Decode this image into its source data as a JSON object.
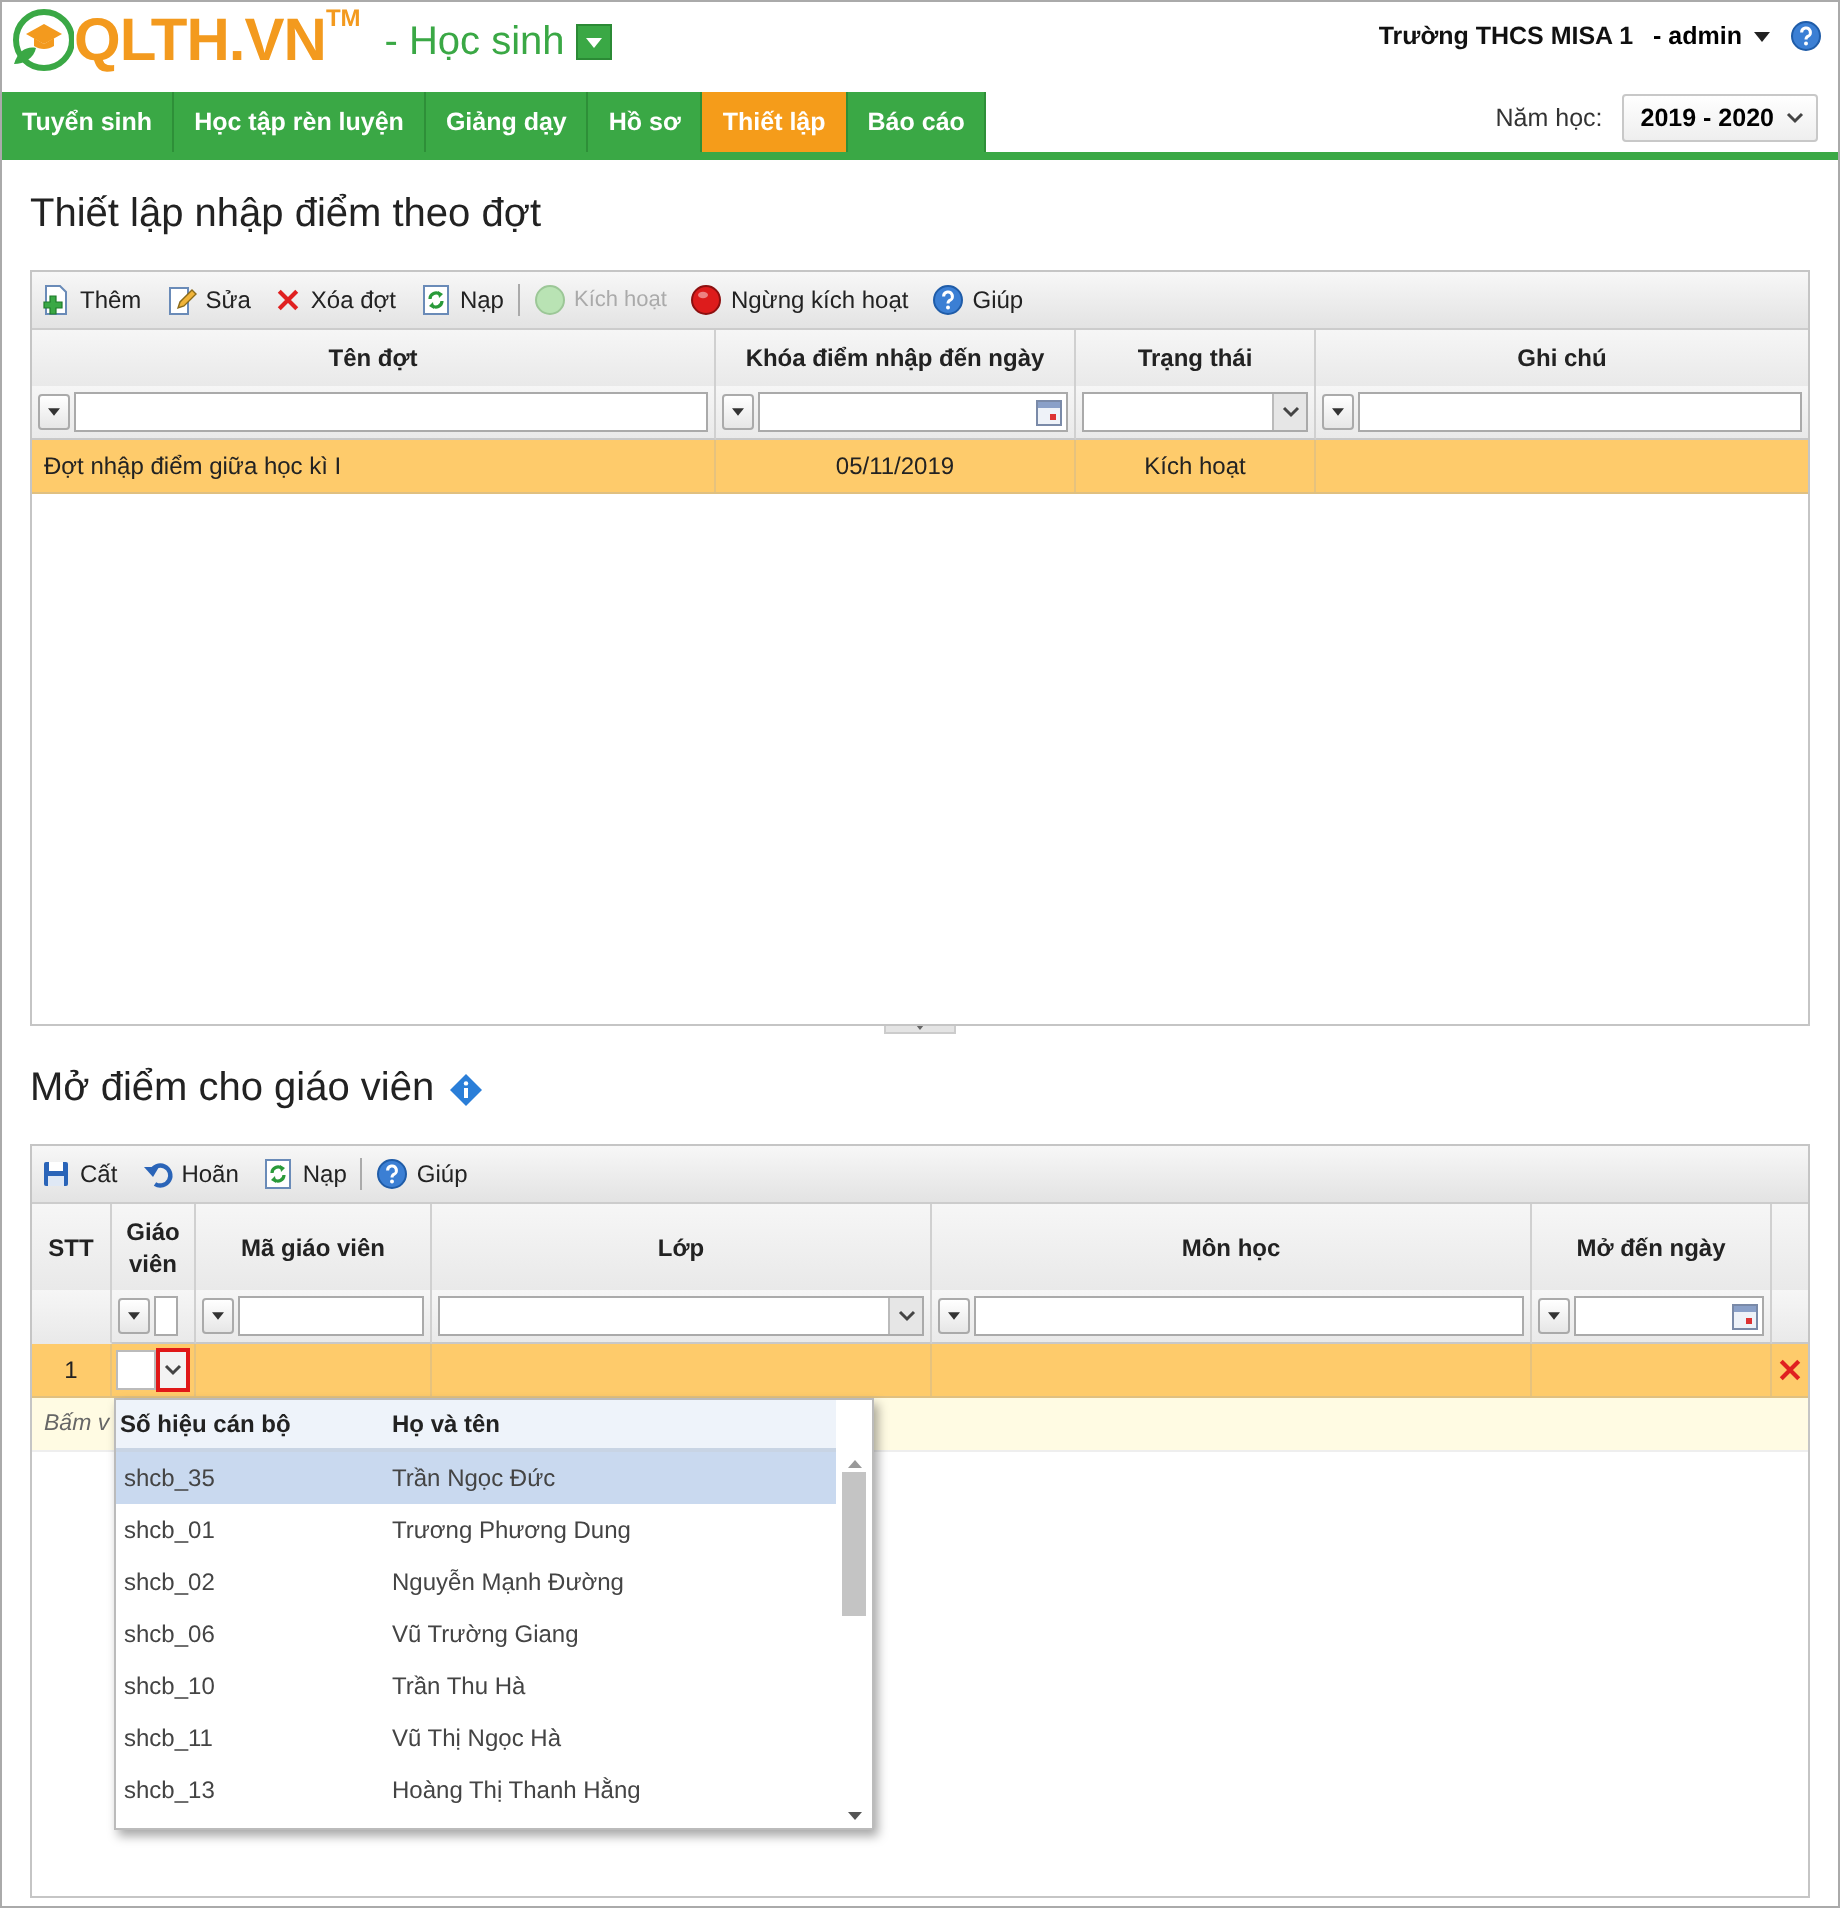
{
  "header": {
    "logo": "QLTH.VN",
    "trademark": "TM",
    "role": "- Học sinh",
    "school": "Trường THCS MISA 1",
    "user": "- admin"
  },
  "nav": {
    "tabs": [
      {
        "label": "Tuyển sinh",
        "selected": false
      },
      {
        "label": "Học tập rèn luyện",
        "selected": false
      },
      {
        "label": "Giảng dạy",
        "selected": false
      },
      {
        "label": "Hồ sơ",
        "selected": false
      },
      {
        "label": "Thiết lập",
        "selected": true
      },
      {
        "label": "Báo cáo",
        "selected": false
      }
    ],
    "year_label": "Năm học:",
    "year": "2019 - 2020"
  },
  "batches": {
    "title": "Thiết lập nhập điểm theo đợt",
    "toolbar": [
      {
        "kind": "add",
        "label": "Thêm",
        "disabled": false
      },
      {
        "kind": "edit",
        "label": "Sửa",
        "disabled": false
      },
      {
        "kind": "delete",
        "label": "Xóa đợt",
        "disabled": false
      },
      {
        "kind": "reload",
        "label": "Nạp",
        "disabled": false
      },
      {
        "kind": "separator"
      },
      {
        "kind": "activate",
        "label": "Kích hoạt",
        "disabled": true
      },
      {
        "kind": "deactivate",
        "label": "Ngừng kích hoạt",
        "disabled": false
      },
      {
        "kind": "help",
        "label": "Giúp",
        "disabled": false
      }
    ],
    "columns": [
      {
        "label": "Tên đợt",
        "kind": "text"
      },
      {
        "label": "Khóa điểm nhập đến ngày",
        "kind": "date"
      },
      {
        "label": "Trạng thái",
        "kind": "select"
      },
      {
        "label": "Ghi chú",
        "kind": "text"
      }
    ],
    "rows": [
      {
        "cells": [
          "Đợt nhập điểm giữa học kì I",
          "05/11/2019",
          "Kích hoạt"
        ],
        "selected": true
      }
    ]
  },
  "teachers": {
    "title": "Mở điểm cho giáo viên",
    "toolbar": [
      {
        "kind": "save",
        "label": "Cất",
        "disabled": false
      },
      {
        "kind": "undo",
        "label": "Hoãn",
        "disabled": false
      },
      {
        "kind": "reload",
        "label": "Nạp",
        "disabled": false
      },
      {
        "kind": "separator"
      },
      {
        "kind": "help",
        "label": "Giúp",
        "disabled": false
      }
    ],
    "columns": [
      {
        "label": "STT",
        "kind": "plain"
      },
      {
        "label": "Giáo viên",
        "kind": "combo"
      },
      {
        "label": "Mã giáo viên",
        "kind": "text"
      },
      {
        "label": "Lớp",
        "kind": "select"
      },
      {
        "label": "Môn học",
        "kind": "text"
      },
      {
        "label": "Mở đến ngày",
        "kind": "date"
      }
    ],
    "rows": [
      {
        "cells": [
          "1"
        ],
        "selected": true,
        "picker_open": true,
        "deletable": true
      }
    ],
    "hint": "Bấm v",
    "picker": {
      "columns": [
        "Số hiệu cán bộ",
        "Họ và tên"
      ],
      "rows": [
        {
          "code": "shcb_35",
          "name": "Trần Ngọc Đức",
          "selected": true
        },
        {
          "code": "shcb_01",
          "name": "Trương Phương Dung",
          "selected": false
        },
        {
          "code": "shcb_02",
          "name": "Nguyễn Mạnh Đường",
          "selected": false
        },
        {
          "code": "shcb_06",
          "name": "Vũ Trường Giang",
          "selected": false
        },
        {
          "code": "shcb_10",
          "name": "Trần Thu Hà",
          "selected": false
        },
        {
          "code": "shcb_11",
          "name": "Vũ Thị Ngọc Hà",
          "selected": false
        },
        {
          "code": "shcb_13",
          "name": "Hoàng Thị Thanh Hằng",
          "selected": false
        }
      ]
    }
  }
}
